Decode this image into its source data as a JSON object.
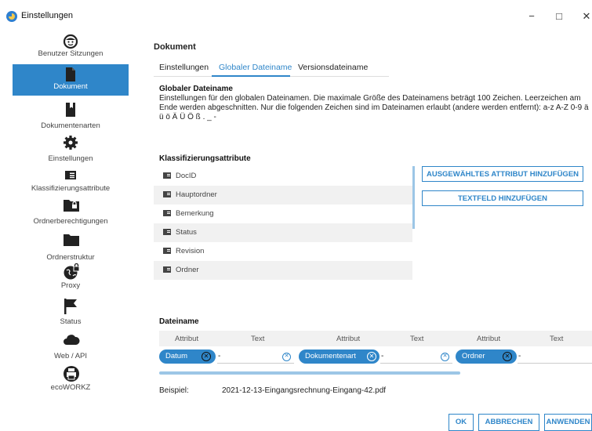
{
  "window": {
    "title": "Einstellungen",
    "minimize": "−",
    "maximize": "□",
    "close": "✕"
  },
  "sidebar": {
    "items": [
      {
        "label": "Benutzer Sitzungen",
        "icon": "smiley-icon"
      },
      {
        "label": "Dokument",
        "icon": "document-icon",
        "active": true
      },
      {
        "label": "Dokumentenarten",
        "icon": "bookmark-icon"
      },
      {
        "label": "Einstellungen",
        "icon": "gear-icon"
      },
      {
        "label": "Klassifizierungsattribute",
        "icon": "tag-list-icon"
      },
      {
        "label": "Ordnerberechtigungen",
        "icon": "folder-lock-icon"
      },
      {
        "label": "Ordnerstruktur",
        "icon": "folder-icon"
      },
      {
        "label": "Proxy",
        "icon": "globe-lock-icon"
      },
      {
        "label": "Status",
        "icon": "flag-icon"
      },
      {
        "label": "Web / API",
        "icon": "cloud-icon"
      },
      {
        "label": "ecoWORKZ",
        "icon": "printer-icon"
      }
    ]
  },
  "main": {
    "heading": "Dokument",
    "tabs": [
      {
        "label": "Einstellungen"
      },
      {
        "label": "Globaler Dateiname",
        "active": true
      },
      {
        "label": "Versionsdateiname"
      }
    ],
    "section_title": "Globaler Dateiname",
    "description": "Einstellungen für den globalen Dateinamen. Die maximale Größe des Dateinamens beträgt 100 Zeichen. Leerzeichen am Ende werden abgeschnitten. Nur die folgenden Zeichen sind im Dateinamen erlaubt (andere werden entfernt): a-z A-Z 0-9 ä ü ö Ä Ü Ö ß . _ -",
    "attributes_title": "Klassifizierungsattribute",
    "attributes": [
      "DocID",
      "Hauptordner",
      "Bemerkung",
      "Status",
      "Revision",
      "Ordner"
    ],
    "add_attribute_button": "AUSGEWÄHLTES ATTRIBUT HINZUFÜGEN",
    "add_textfield_button": "TEXTFELD HINZUFÜGEN",
    "filename_title": "Dateiname",
    "filename_headers": [
      "Attribut",
      "Text",
      "Attribut",
      "Text",
      "Attribut",
      "Text"
    ],
    "filename_parts": [
      {
        "attribute": "Datum",
        "text": "-"
      },
      {
        "attribute": "Dokumentenart",
        "text": "-"
      },
      {
        "attribute": "Ordner",
        "text": "-"
      }
    ],
    "example_label": "Beispiel:",
    "example_value": "2021-12-13-Eingangsrechnung-Eingang-42.pdf"
  },
  "footer": {
    "ok": "OK",
    "cancel": "ABBRECHEN",
    "apply": "ANWENDEN"
  },
  "colors": {
    "accent": "#2f86c9",
    "stripe": "#f1f1f1"
  }
}
